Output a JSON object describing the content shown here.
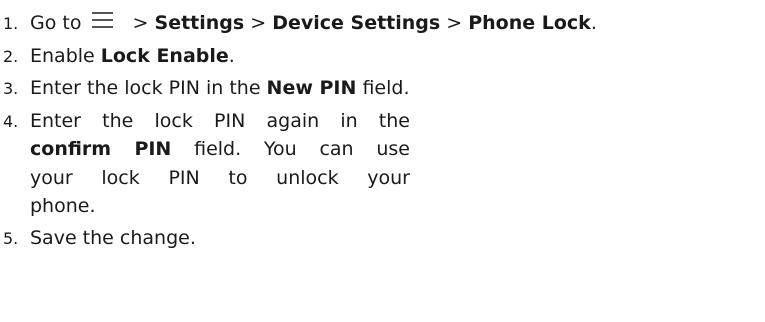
{
  "steps": [
    {
      "number": "1.",
      "prefix": "Go to",
      "icon": "menu-icon",
      "sep1": " > ",
      "item1": "Settings",
      "sep2": " > ",
      "item2": "Device Settings",
      "sep3": " > ",
      "item3": "Phone Lock",
      "end": "."
    },
    {
      "number": "2.",
      "prefix": "Enable ",
      "bold": "Lock Enable",
      "suffix": "."
    },
    {
      "number": "3.",
      "prefix": "Enter the lock PIN in the ",
      "bold": "New PIN",
      "suffix": " field."
    },
    {
      "number": "4.",
      "line1": "Enter the lock PIN again in the",
      "bold": "confirm PIN",
      "line2_rest": " field. You can use",
      "line3": "your lock PIN to unlock your",
      "line4": "phone."
    },
    {
      "number": "5.",
      "text": "Save the change."
    }
  ]
}
